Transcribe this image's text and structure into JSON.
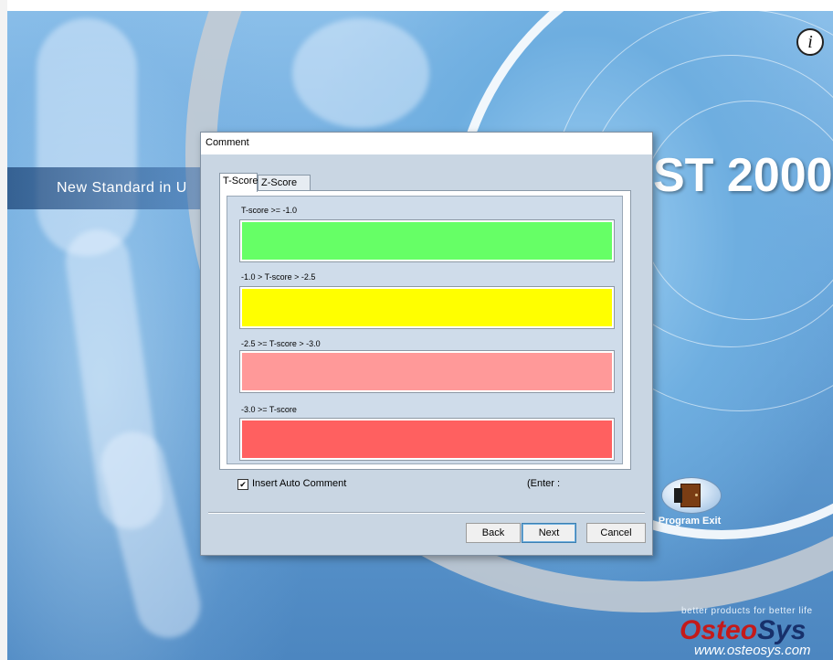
{
  "app": {
    "product_title": "ST 2000",
    "banner_text": "New Standard in U",
    "info_button": "i",
    "program_exit_label": "Program Exit",
    "tagline": "better products for better life",
    "brand_part1": "Osteo",
    "brand_part2": "Sys",
    "website": "www.osteosys.com"
  },
  "dialog": {
    "title": "Comment",
    "tabs": [
      {
        "label": "T-Score",
        "active": true
      },
      {
        "label": "Z-Score",
        "active": false
      }
    ],
    "ranges": [
      {
        "label": "T-score >= -1.0",
        "color": "#66ff66",
        "value": ""
      },
      {
        "label": "-1.0 > T-score  > -2.5",
        "color": "#ffff00",
        "value": ""
      },
      {
        "label": "-2.5 >= T-score  > -3.0",
        "color": "#ff9999",
        "value": ""
      },
      {
        "label": "-3.0 >= T-score",
        "color": "#ff6060",
        "value": ""
      }
    ],
    "auto_comment": {
      "label": "Insert Auto Comment",
      "checked": true,
      "check_glyph": "✔"
    },
    "enter_hint": "(Enter :",
    "buttons": {
      "back": "Back",
      "next": "Next",
      "cancel": "Cancel"
    }
  }
}
